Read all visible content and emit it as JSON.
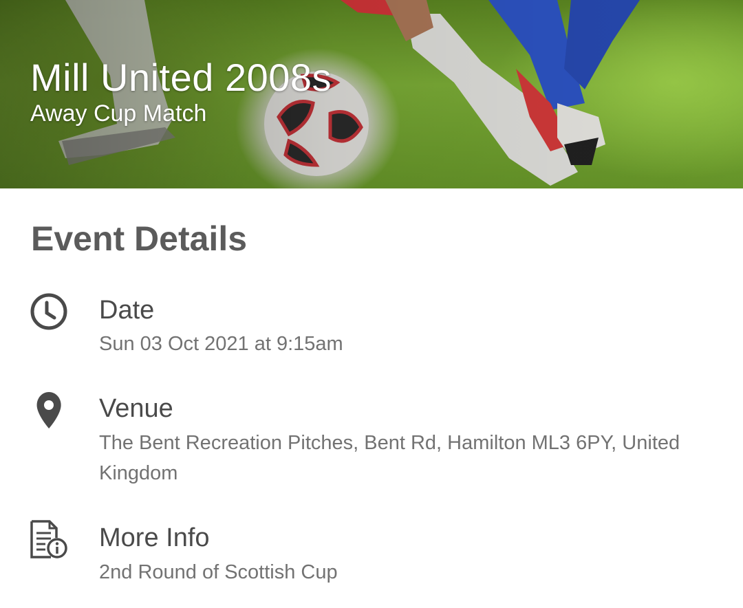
{
  "header": {
    "title": "Mill United 2008s",
    "subtitle": "Away Cup Match",
    "banner_image": "football-players-match-illustration"
  },
  "section": {
    "title": "Event Details"
  },
  "details": [
    {
      "icon": "clock-icon",
      "label": "Date",
      "value": "Sun 03 Oct 2021 at 9:15am"
    },
    {
      "icon": "location-pin-icon",
      "label": "Venue",
      "value": "The Bent Recreation Pitches, Bent Rd, Hamilton ML3 6PY, United Kingdom"
    },
    {
      "icon": "document-info-icon",
      "label": "More Info",
      "value": "2nd Round of Scottish Cup"
    }
  ],
  "colors": {
    "label": "#4a4a4a",
    "value": "#727272",
    "section_title": "#5b5b5b",
    "icon": "#4a4a4a"
  }
}
